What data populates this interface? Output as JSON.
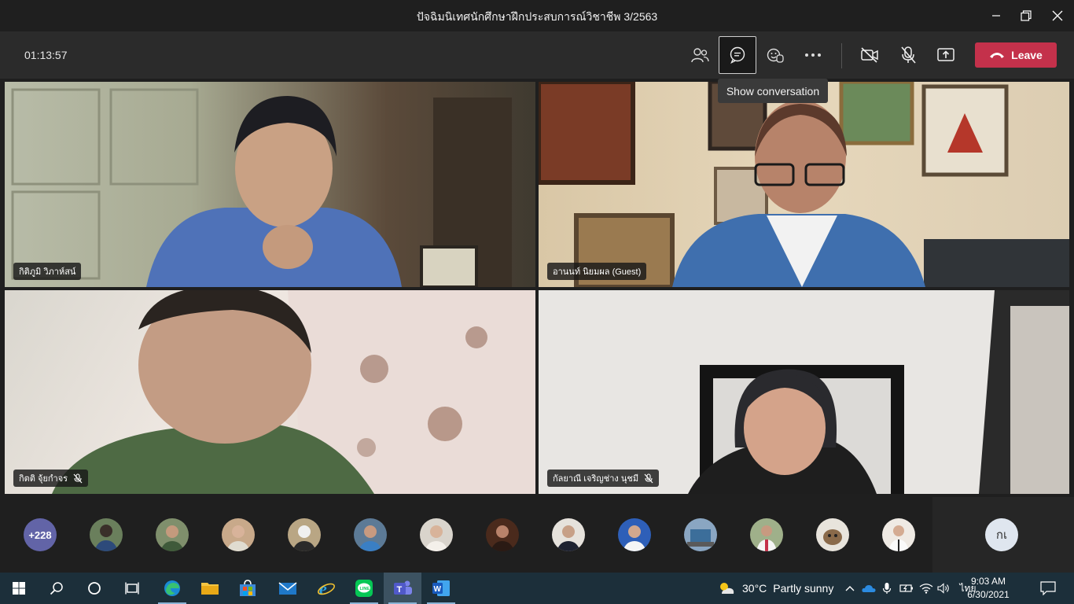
{
  "window": {
    "title": "ปัจฉิมนิเทศนักศึกษาฝึกประสบการณ์วิชาชีพ 3/2563"
  },
  "toolbar": {
    "timer": "01:13:57",
    "leave_label": "Leave",
    "tooltip": "Show conversation"
  },
  "tiles": [
    {
      "name": "กิติภูมิ วิภาห์สน์",
      "muted": false
    },
    {
      "name": "อานนท์ นิยมผล (Guest)",
      "muted": false
    },
    {
      "name": "กิตติ จุ้ยกำจร",
      "muted": true
    },
    {
      "name": "กัลยาณี เจริญช่าง นุชมี",
      "muted": true
    }
  ],
  "participants": {
    "overflow_count": "+228",
    "current_user_initials": "กเ"
  },
  "taskbar": {
    "weather_temp": "30°C",
    "weather_desc": "Partly sunny",
    "language": "ไทย",
    "time": "9:03 AM",
    "date": "6/30/2021"
  },
  "colors": {
    "leave": "#c4314b",
    "teams_purple": "#6264a7",
    "taskbar": "#1c2f3a"
  }
}
